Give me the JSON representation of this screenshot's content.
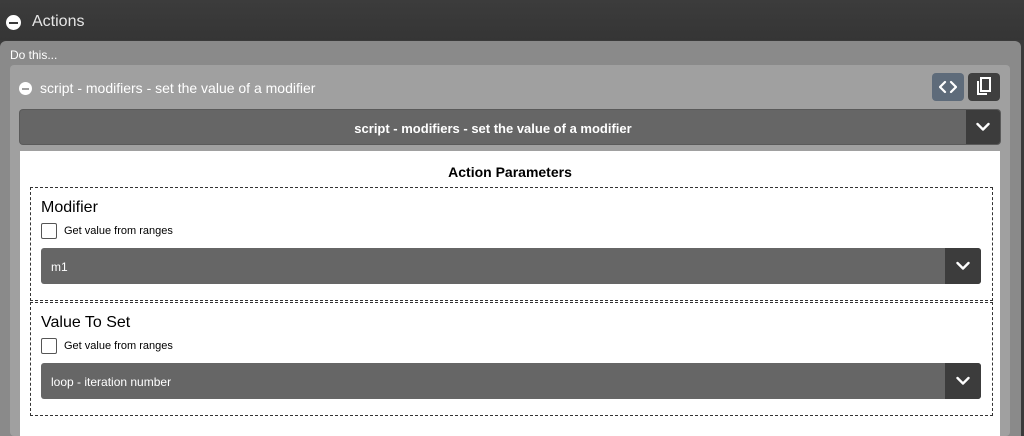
{
  "header": {
    "title": "Actions"
  },
  "panel": {
    "do_this_label": "Do this..."
  },
  "action": {
    "title": "script - modifiers - set the value of a modifier",
    "selected": "script - modifiers - set the value of a modifier",
    "code_icon": "code-brackets-icon",
    "copy_icon": "copy-icon"
  },
  "parameters": {
    "title": "Action Parameters",
    "modifier": {
      "label": "Modifier",
      "checkbox_label": "Get value from ranges",
      "checked": false,
      "value": "m1"
    },
    "value_to_set": {
      "label": "Value To Set",
      "checkbox_label": "Get value from ranges",
      "checked": false,
      "value": "loop - iteration number"
    }
  },
  "colors": {
    "accent_button": "#5e6b7a",
    "select_background": "#666666",
    "panel_background": "#a0a0a0"
  }
}
